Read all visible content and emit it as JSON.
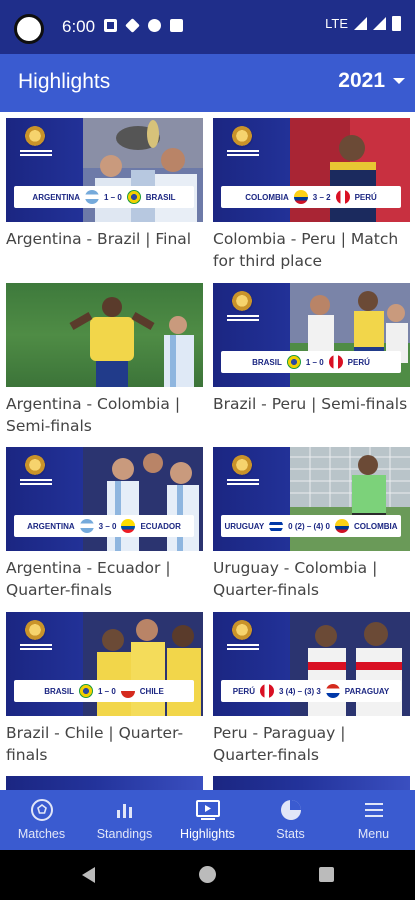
{
  "status_bar": {
    "time": "6:00",
    "network": "LTE"
  },
  "app_bar": {
    "title": "Highlights",
    "year": "2021"
  },
  "cards": [
    {
      "caption": "Argentina - Brazil | Final",
      "home": "ARGENTINA",
      "score": "1 – 0",
      "away": "BRASIL"
    },
    {
      "caption": "Colombia - Peru | Match for third place",
      "home": "COLOMBIA",
      "score": "3 – 2",
      "away": "PERÚ"
    },
    {
      "caption": "Argentina - Colombia | Semi-finals"
    },
    {
      "caption": "Brazil - Peru | Semi-finals",
      "home": "BRASIL",
      "score": "1 – 0",
      "away": "PERÚ"
    },
    {
      "caption": "Argentina - Ecuador | Quarter-finals",
      "home": "ARGENTINA",
      "score": "3 – 0",
      "away": "ECUADOR"
    },
    {
      "caption": "Uruguay - Colombia | Quarter-finals",
      "home": "URUGUAY",
      "score": "0 (2) – (4) 0",
      "away": "COLOMBIA"
    },
    {
      "caption": "Brazil - Chile | Quarter-finals",
      "home": "BRASIL",
      "score": "1 – 0",
      "away": "CHILE"
    },
    {
      "caption": "Peru - Paraguay | Quarter-finals",
      "home": "PERÚ",
      "score": "3 (4) – (3) 3",
      "away": "PARAGUAY"
    }
  ],
  "bottom_nav": [
    {
      "label": "Matches",
      "icon": "soccer-ball-icon"
    },
    {
      "label": "Standings",
      "icon": "bar-chart-icon"
    },
    {
      "label": "Highlights",
      "icon": "video-icon"
    },
    {
      "label": "Stats",
      "icon": "pie-chart-icon"
    },
    {
      "label": "Menu",
      "icon": "hamburger-menu-icon"
    }
  ],
  "colors": {
    "primary": "#3a5bd0",
    "status_bar": "#1f2e8a",
    "thumb_blue": "#1b2682"
  }
}
